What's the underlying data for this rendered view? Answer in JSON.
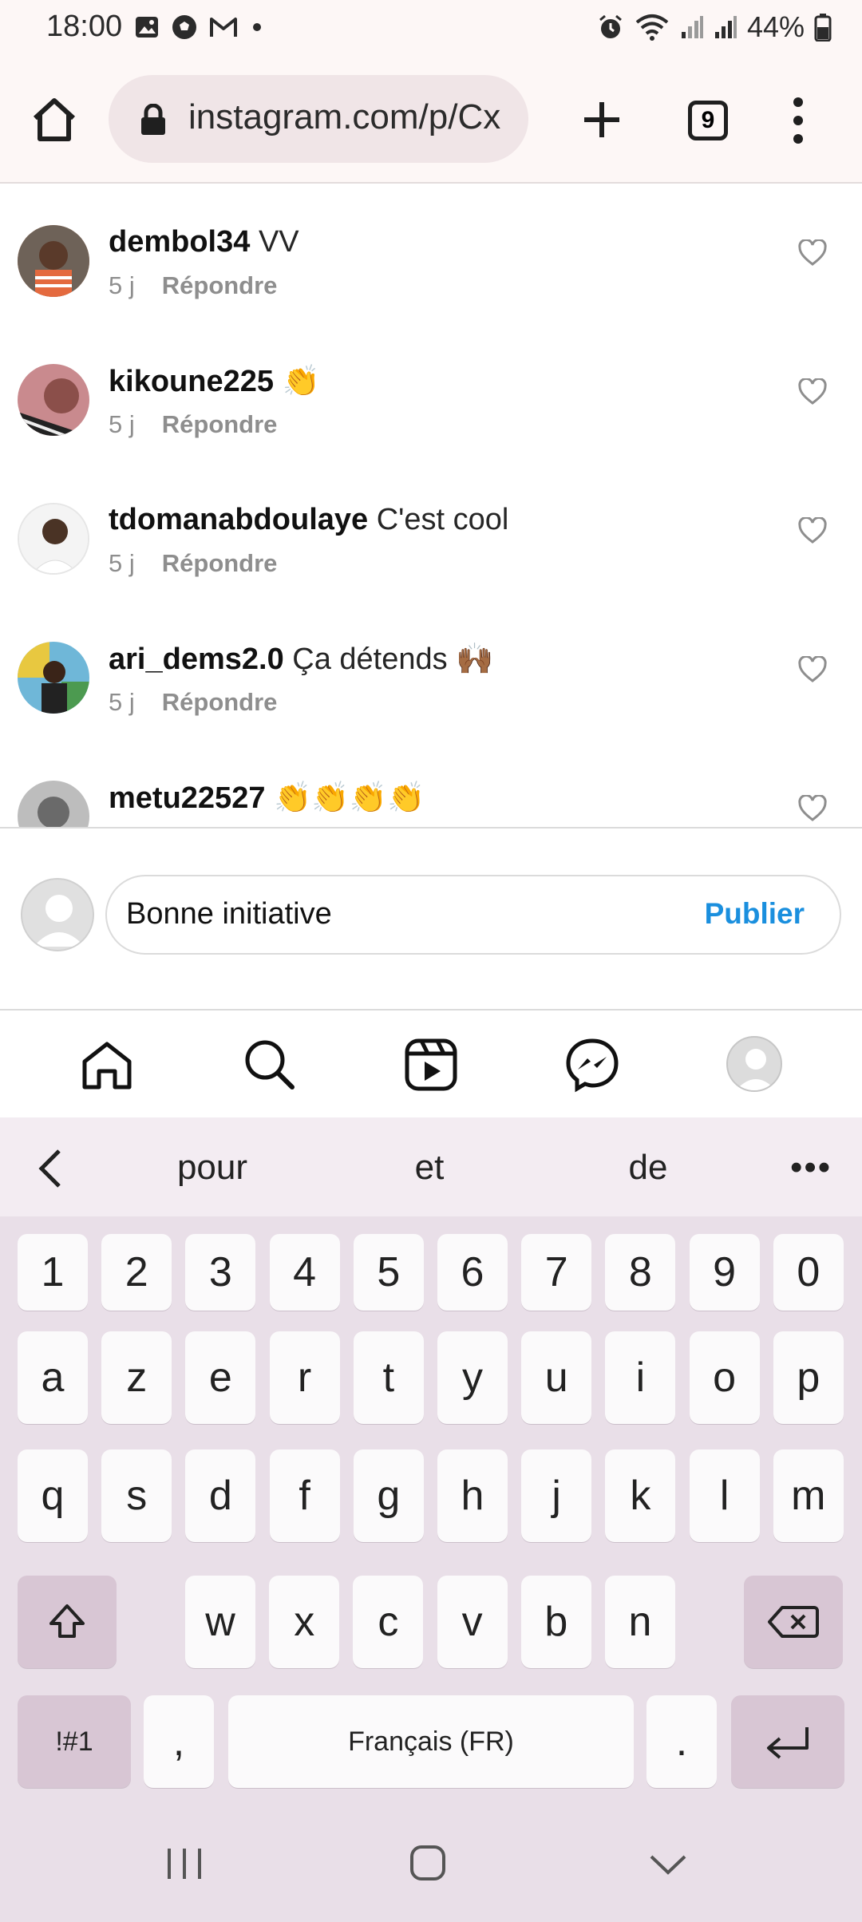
{
  "status_bar": {
    "time": "18:00",
    "battery": "44%"
  },
  "browser": {
    "url": "instagram.com/p/Cx",
    "tab_count": "9"
  },
  "comments": [
    {
      "user": "dembol34",
      "text": "VV",
      "age": "5 j",
      "reply": "Répondre",
      "avatar_color": "#b05a3c"
    },
    {
      "user": "kikoune225",
      "text": "👏",
      "age": "5 j",
      "reply": "Répondre",
      "avatar_color": "#7a4a52"
    },
    {
      "user": "tdomanabdoulaye",
      "text": "C'est cool",
      "age": "5 j",
      "reply": "Répondre",
      "avatar_color": "#d9d9d9"
    },
    {
      "user": "ari_dems2.0",
      "text": "Ça détends 🙌🏾",
      "age": "5 j",
      "reply": "Répondre",
      "avatar_color": "#4f8fbf"
    },
    {
      "user": "metu22527",
      "text": "👏👏👏👏",
      "age": "",
      "reply": "",
      "avatar_color": "#9a9a9a"
    }
  ],
  "compose": {
    "value": "Bonne initiative",
    "publish_label": "Publier"
  },
  "keyboard": {
    "suggestions": [
      "pour",
      "et",
      "de"
    ],
    "row_numbers": [
      "1",
      "2",
      "3",
      "4",
      "5",
      "6",
      "7",
      "8",
      "9",
      "0"
    ],
    "row_1": [
      "a",
      "z",
      "e",
      "r",
      "t",
      "y",
      "u",
      "i",
      "o",
      "p"
    ],
    "row_2": [
      "q",
      "s",
      "d",
      "f",
      "g",
      "h",
      "j",
      "k",
      "l",
      "m"
    ],
    "row_3": [
      "w",
      "x",
      "c",
      "v",
      "b",
      "n"
    ],
    "symbols_label": "!#1",
    "comma": ",",
    "space_label": "Français (FR)",
    "period": "."
  },
  "colors": {
    "accent": "#1a8fde",
    "keyboard_bg": "#e9dfe8",
    "browser_bg": "#fdf7f6"
  }
}
